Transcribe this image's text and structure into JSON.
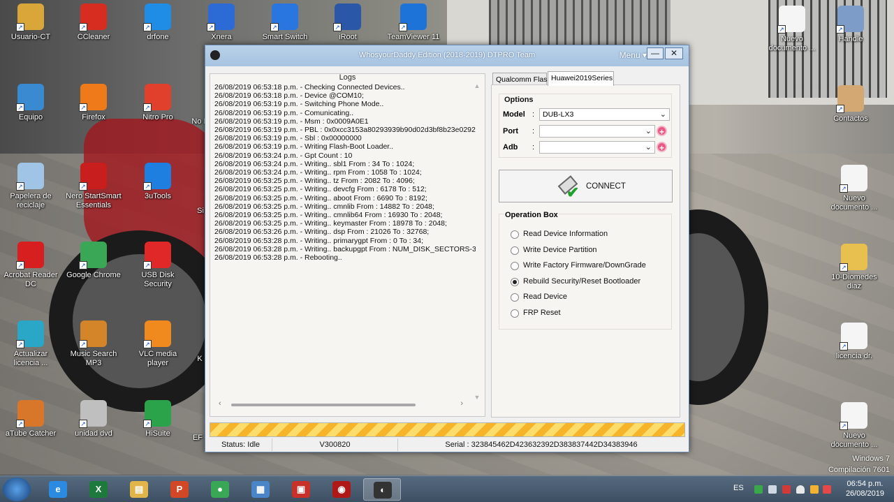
{
  "desktop": {
    "icons": [
      {
        "label": "Usuario-CT",
        "color": "#d9a63a"
      },
      {
        "label": "CCleaner",
        "color": "#d62d20"
      },
      {
        "label": "drfone",
        "color": "#1f8de6"
      },
      {
        "label": "Xnera",
        "color": "#2c6bd6"
      },
      {
        "label": "Smart Switch",
        "color": "#2a76e0"
      },
      {
        "label": "iRoot",
        "color": "#2a57a7"
      },
      {
        "label": "TeamViewer 11",
        "color": "#1d73d8"
      },
      {
        "label": "Equipo",
        "color": "#3a8ad2"
      },
      {
        "label": "Firefox",
        "color": "#ef7a1a"
      },
      {
        "label": "Nitro Pro",
        "color": "#e0402c"
      },
      {
        "label": "Papelera de reciclaje",
        "color": "#9fc4e6"
      },
      {
        "label": "Nero StartSmart Essentials",
        "color": "#c81e1e"
      },
      {
        "label": "3uTools",
        "color": "#1f7fe0"
      },
      {
        "label": "Acrobat Reader DC",
        "color": "#d71f1f"
      },
      {
        "label": "Google Chrome",
        "color": "#3aa757"
      },
      {
        "label": "USB Disk Security",
        "color": "#e02828"
      },
      {
        "label": "Actualizar licencia ...",
        "color": "#2aa6c7"
      },
      {
        "label": "Music Search MP3",
        "color": "#d4852a"
      },
      {
        "label": "VLC media player",
        "color": "#f08a1e"
      },
      {
        "label": "aTube Catcher",
        "color": "#d8762a"
      },
      {
        "label": "unidad dvd",
        "color": "#bfbfbf"
      },
      {
        "label": "HiSuite",
        "color": "#2aa34a"
      },
      {
        "label": "Nuevo documento ...",
        "color": "#f5f5f5"
      },
      {
        "label": "Handle",
        "color": "#7d9cc7"
      },
      {
        "label": "Contactos",
        "color": "#d4a872"
      },
      {
        "label": "Nuevo documento ...",
        "color": "#f5f5f5"
      },
      {
        "label": "10-Diomedes diaz",
        "color": "#e8c050"
      },
      {
        "label": "licencia dr.",
        "color": "#f5f5f5"
      },
      {
        "label": "Nuevo documento ...",
        "color": "#f5f5f5"
      }
    ],
    "partial_labels": [
      "No Re",
      "Si",
      "K",
      "EF"
    ]
  },
  "window": {
    "title": "WhosyourDaddy Edition (2018-2019) DTPRO Team",
    "menu_label": "Menu ▾",
    "min_glyph": "—",
    "close_glyph": "✕"
  },
  "logs": {
    "title": "Logs",
    "lines": [
      "26/08/2019 06:53:18 p.m. - Checking Connected Devices..",
      "26/08/2019 06:53:18 p.m. - Device @COM10;",
      "26/08/2019 06:53:19 p.m. - Switching Phone Mode..",
      "26/08/2019 06:53:19 p.m. - Comunicating..",
      "26/08/2019 06:53:19 p.m. - Msm : 0x0009A0E1",
      "26/08/2019 06:53:19 p.m. - PBL : 0x0xcc3153a80293939b90d02d3bf8b23e0292",
      "26/08/2019 06:53:19 p.m. - Sbl : 0x00000000",
      "26/08/2019 06:53:19 p.m. - Writing Flash-Boot Loader..",
      "26/08/2019 06:53:24 p.m. - Gpt Count : 10",
      "26/08/2019 06:53:24 p.m. - Writing.. sbl1 From : 34 To : 1024;",
      "26/08/2019 06:53:24 p.m. - Writing.. rpm From : 1058 To : 1024;",
      "26/08/2019 06:53:25 p.m. - Writing.. tz From : 2082 To : 4096;",
      "26/08/2019 06:53:25 p.m. - Writing.. devcfg From : 6178 To : 512;",
      "26/08/2019 06:53:25 p.m. - Writing.. aboot From : 6690 To : 8192;",
      "26/08/2019 06:53:25 p.m. - Writing.. cmnlib From : 14882 To : 2048;",
      "26/08/2019 06:53:25 p.m. - Writing.. cmnlib64 From : 16930 To : 2048;",
      "26/08/2019 06:53:25 p.m. - Writing.. keymaster From : 18978 To : 2048;",
      "26/08/2019 06:53:26 p.m. - Writing.. dsp From : 21026 To : 32768;",
      "26/08/2019 06:53:28 p.m. - Writing.. primarygpt From : 0 To : 34;",
      "26/08/2019 06:53:28 p.m. - Writing.. backupgpt From : NUM_DISK_SECTORS-3",
      "26/08/2019 06:53:28 p.m. - Rebooting.."
    ]
  },
  "tabs": [
    {
      "label": "Qualcomm Flash",
      "active": false
    },
    {
      "label": "Huawei2019Series",
      "active": true
    }
  ],
  "options": {
    "title": "Options",
    "model_label": "Model",
    "model_value": "DUB-LX3",
    "port_label": "Port",
    "port_value": "",
    "adb_label": "Adb",
    "adb_value": "",
    "colon": ":",
    "add_glyph": "+"
  },
  "connect": {
    "label": "CONNECT"
  },
  "operation_box": {
    "title": "Operation Box",
    "items": [
      {
        "label": "Read Device Information",
        "selected": false
      },
      {
        "label": "Write Device Partition",
        "selected": false
      },
      {
        "label": "Write Factory Firmware/DownGrade",
        "selected": false
      },
      {
        "label": "Rebuild Security/Reset Bootloader",
        "selected": true
      },
      {
        "label": "Read Device",
        "selected": false
      },
      {
        "label": "FRP Reset",
        "selected": false
      }
    ]
  },
  "statusbar": {
    "status": "Status: Idle",
    "version": "V300820",
    "serial": "Serial : 323845462D423632392D383837442D34383946"
  },
  "taskbar": {
    "apps": [
      {
        "name": "ie",
        "glyph": "e",
        "color": "#2a8be0"
      },
      {
        "name": "excel",
        "glyph": "X",
        "color": "#1e7a3c"
      },
      {
        "name": "explorer",
        "glyph": "▤",
        "color": "#e2b54a"
      },
      {
        "name": "powerpoint",
        "glyph": "P",
        "color": "#d24726"
      },
      {
        "name": "chrome",
        "glyph": "●",
        "color": "#3aa757"
      },
      {
        "name": "network",
        "glyph": "▦",
        "color": "#4a86c7"
      },
      {
        "name": "toolbox",
        "glyph": "▣",
        "color": "#c8302a"
      },
      {
        "name": "redtool",
        "glyph": "◉",
        "color": "#b01818"
      },
      {
        "name": "dtpro",
        "glyph": "◐",
        "color": "#333333"
      }
    ],
    "lang": "ES",
    "time": "06:54 p.m.",
    "date": "26/08/2019"
  },
  "watermark": {
    "line1": "Windows 7",
    "line2": "Compilación 7601"
  }
}
